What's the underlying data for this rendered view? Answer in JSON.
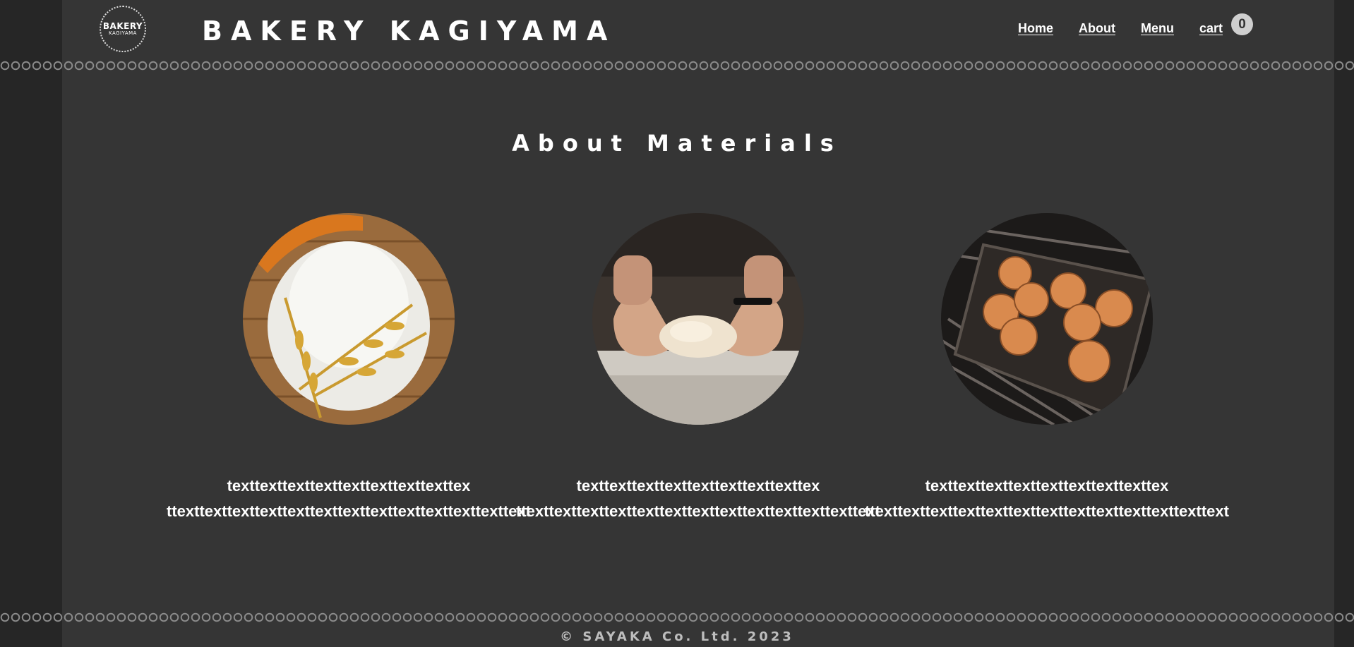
{
  "header": {
    "logo": {
      "top": "BAKERY",
      "bottom": "KAGIYAMA"
    },
    "title": "BAKERY KAGIYAMA",
    "nav": [
      {
        "label": "Home"
      },
      {
        "label": "About"
      },
      {
        "label": "Menu"
      },
      {
        "label": "cart"
      }
    ],
    "cart_count": "0"
  },
  "main": {
    "heading": "About Materials",
    "cards": [
      {
        "image": "flour-and-wheat-photo",
        "line1": "texttexttexttexttexttexttexttexttex",
        "line2": "ttexttexttexttexttexttexttexttexttexttexttexttexttext"
      },
      {
        "image": "kneading-dough-photo",
        "line1": "texttexttexttexttexttexttexttexttex",
        "line2": "ttexttexttexttexttexttexttexttexttexttexttexttexttext"
      },
      {
        "image": "bread-rolls-oven-photo",
        "line1": "texttexttexttexttexttexttexttexttex",
        "line2": "ttexttexttexttexttexttexttexttexttexttexttexttexttext"
      }
    ]
  },
  "footer": {
    "copyright": "© SAYAKA Co. Ltd. 2023"
  },
  "colors": {
    "background": "#353535",
    "text": "#ffffff",
    "badge": "#cfcfcf"
  }
}
